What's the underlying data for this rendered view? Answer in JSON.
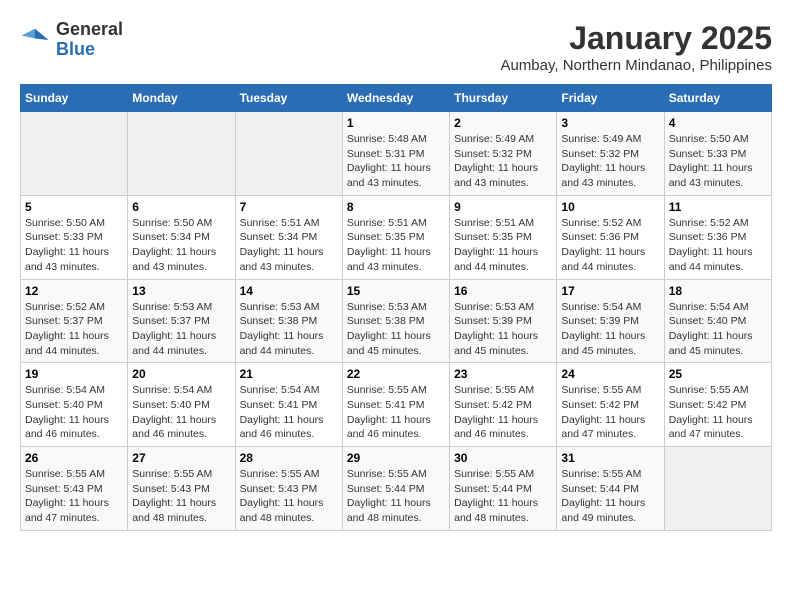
{
  "header": {
    "logo_general": "General",
    "logo_blue": "Blue",
    "title": "January 2025",
    "subtitle": "Aumbay, Northern Mindanao, Philippines"
  },
  "calendar": {
    "days_of_week": [
      "Sunday",
      "Monday",
      "Tuesday",
      "Wednesday",
      "Thursday",
      "Friday",
      "Saturday"
    ],
    "weeks": [
      [
        {
          "day": "",
          "info": ""
        },
        {
          "day": "",
          "info": ""
        },
        {
          "day": "",
          "info": ""
        },
        {
          "day": "1",
          "info": "Sunrise: 5:48 AM\nSunset: 5:31 PM\nDaylight: 11 hours and 43 minutes."
        },
        {
          "day": "2",
          "info": "Sunrise: 5:49 AM\nSunset: 5:32 PM\nDaylight: 11 hours and 43 minutes."
        },
        {
          "day": "3",
          "info": "Sunrise: 5:49 AM\nSunset: 5:32 PM\nDaylight: 11 hours and 43 minutes."
        },
        {
          "day": "4",
          "info": "Sunrise: 5:50 AM\nSunset: 5:33 PM\nDaylight: 11 hours and 43 minutes."
        }
      ],
      [
        {
          "day": "5",
          "info": "Sunrise: 5:50 AM\nSunset: 5:33 PM\nDaylight: 11 hours and 43 minutes."
        },
        {
          "day": "6",
          "info": "Sunrise: 5:50 AM\nSunset: 5:34 PM\nDaylight: 11 hours and 43 minutes."
        },
        {
          "day": "7",
          "info": "Sunrise: 5:51 AM\nSunset: 5:34 PM\nDaylight: 11 hours and 43 minutes."
        },
        {
          "day": "8",
          "info": "Sunrise: 5:51 AM\nSunset: 5:35 PM\nDaylight: 11 hours and 43 minutes."
        },
        {
          "day": "9",
          "info": "Sunrise: 5:51 AM\nSunset: 5:35 PM\nDaylight: 11 hours and 44 minutes."
        },
        {
          "day": "10",
          "info": "Sunrise: 5:52 AM\nSunset: 5:36 PM\nDaylight: 11 hours and 44 minutes."
        },
        {
          "day": "11",
          "info": "Sunrise: 5:52 AM\nSunset: 5:36 PM\nDaylight: 11 hours and 44 minutes."
        }
      ],
      [
        {
          "day": "12",
          "info": "Sunrise: 5:52 AM\nSunset: 5:37 PM\nDaylight: 11 hours and 44 minutes."
        },
        {
          "day": "13",
          "info": "Sunrise: 5:53 AM\nSunset: 5:37 PM\nDaylight: 11 hours and 44 minutes."
        },
        {
          "day": "14",
          "info": "Sunrise: 5:53 AM\nSunset: 5:38 PM\nDaylight: 11 hours and 44 minutes."
        },
        {
          "day": "15",
          "info": "Sunrise: 5:53 AM\nSunset: 5:38 PM\nDaylight: 11 hours and 45 minutes."
        },
        {
          "day": "16",
          "info": "Sunrise: 5:53 AM\nSunset: 5:39 PM\nDaylight: 11 hours and 45 minutes."
        },
        {
          "day": "17",
          "info": "Sunrise: 5:54 AM\nSunset: 5:39 PM\nDaylight: 11 hours and 45 minutes."
        },
        {
          "day": "18",
          "info": "Sunrise: 5:54 AM\nSunset: 5:40 PM\nDaylight: 11 hours and 45 minutes."
        }
      ],
      [
        {
          "day": "19",
          "info": "Sunrise: 5:54 AM\nSunset: 5:40 PM\nDaylight: 11 hours and 46 minutes."
        },
        {
          "day": "20",
          "info": "Sunrise: 5:54 AM\nSunset: 5:40 PM\nDaylight: 11 hours and 46 minutes."
        },
        {
          "day": "21",
          "info": "Sunrise: 5:54 AM\nSunset: 5:41 PM\nDaylight: 11 hours and 46 minutes."
        },
        {
          "day": "22",
          "info": "Sunrise: 5:55 AM\nSunset: 5:41 PM\nDaylight: 11 hours and 46 minutes."
        },
        {
          "day": "23",
          "info": "Sunrise: 5:55 AM\nSunset: 5:42 PM\nDaylight: 11 hours and 46 minutes."
        },
        {
          "day": "24",
          "info": "Sunrise: 5:55 AM\nSunset: 5:42 PM\nDaylight: 11 hours and 47 minutes."
        },
        {
          "day": "25",
          "info": "Sunrise: 5:55 AM\nSunset: 5:42 PM\nDaylight: 11 hours and 47 minutes."
        }
      ],
      [
        {
          "day": "26",
          "info": "Sunrise: 5:55 AM\nSunset: 5:43 PM\nDaylight: 11 hours and 47 minutes."
        },
        {
          "day": "27",
          "info": "Sunrise: 5:55 AM\nSunset: 5:43 PM\nDaylight: 11 hours and 48 minutes."
        },
        {
          "day": "28",
          "info": "Sunrise: 5:55 AM\nSunset: 5:43 PM\nDaylight: 11 hours and 48 minutes."
        },
        {
          "day": "29",
          "info": "Sunrise: 5:55 AM\nSunset: 5:44 PM\nDaylight: 11 hours and 48 minutes."
        },
        {
          "day": "30",
          "info": "Sunrise: 5:55 AM\nSunset: 5:44 PM\nDaylight: 11 hours and 48 minutes."
        },
        {
          "day": "31",
          "info": "Sunrise: 5:55 AM\nSunset: 5:44 PM\nDaylight: 11 hours and 49 minutes."
        },
        {
          "day": "",
          "info": ""
        }
      ]
    ]
  }
}
